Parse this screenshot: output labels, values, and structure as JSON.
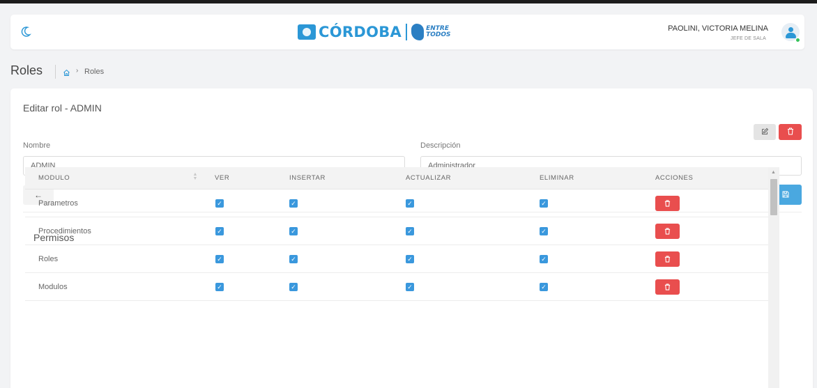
{
  "header": {
    "logo_text": "CÓRDOBA",
    "logo_tagline_1": "ENTRE",
    "logo_tagline_2": "TODOS",
    "user_name": "PAOLINI, VICTORIA MELINA",
    "user_role": "JEFE DE SALA"
  },
  "page": {
    "title": "Roles",
    "breadcrumb": [
      "Roles"
    ]
  },
  "form": {
    "card_title": "Editar rol - ADMIN",
    "nombre_label": "Nombre",
    "nombre_value": "ADMIN",
    "descripcion_label": "Descripción",
    "descripcion_value": "Administrador",
    "back_icon": "←"
  },
  "permisos": {
    "title": "Permisos",
    "columns": [
      "MODULO",
      "VER",
      "INSERTAR",
      "ACTUALIZAR",
      "ELIMINAR",
      "ACCIONES"
    ],
    "rows": [
      {
        "modulo": "Parametros",
        "ver": true,
        "insertar": true,
        "actualizar": true,
        "eliminar": true
      },
      {
        "modulo": "Procedimientos",
        "ver": true,
        "insertar": true,
        "actualizar": true,
        "eliminar": true
      },
      {
        "modulo": "Roles",
        "ver": true,
        "insertar": true,
        "actualizar": true,
        "eliminar": true
      },
      {
        "modulo": "Modulos",
        "ver": true,
        "insertar": true,
        "actualizar": true,
        "eliminar": true
      }
    ]
  },
  "colors": {
    "accent": "#2b97d6",
    "danger": "#e94e4e",
    "save": "#4aa8e0",
    "online": "#36c25b"
  },
  "icons": {
    "theme_toggle": "moon-icon",
    "home": "home-icon",
    "edit": "edit-icon",
    "delete": "trash-icon",
    "save": "save-icon",
    "back": "arrow-left-icon"
  }
}
